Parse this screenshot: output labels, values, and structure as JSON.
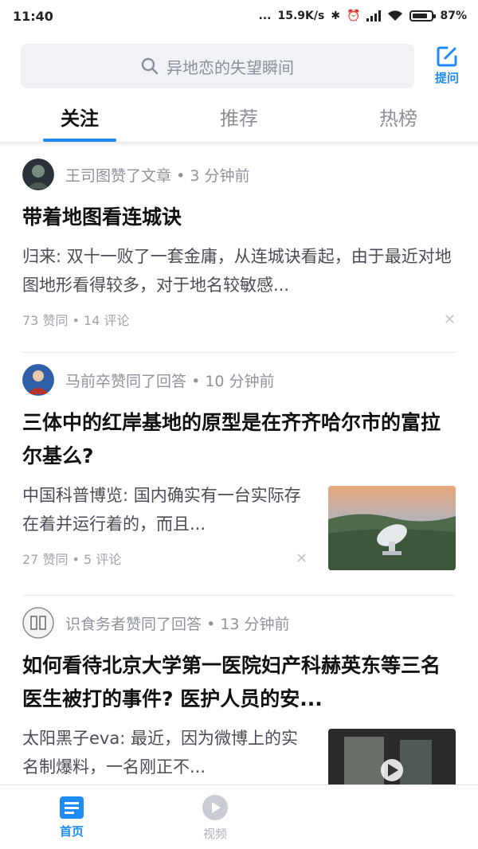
{
  "status_bar": {
    "time": "11:40",
    "dots": "...",
    "speed": "15.9K/s",
    "battery": "87%"
  },
  "header": {
    "search_placeholder": "异地恋的失望瞬间",
    "ask_label": "提问"
  },
  "tabs": [
    {
      "label": "关注",
      "active": true
    },
    {
      "label": "推荐",
      "active": false
    },
    {
      "label": "热榜",
      "active": false
    }
  ],
  "feed": [
    {
      "actor": "王司图赞了文章",
      "time_ago": "3 分钟前",
      "title": "带着地图看连城诀",
      "excerpt": "归来: 双十一败了一套金庸，从连城诀看起，由于最近对地图地形看得较多，对于地名较敏感...",
      "stats": "73 赞同 • 14 评论"
    },
    {
      "actor": "马前卒赞同了回答",
      "time_ago": "10 分钟前",
      "title": "三体中的红岸基地的原型是在齐齐哈尔市的富拉尔基么?",
      "excerpt": "中国科普博览: 国内确实有一台实际存在着并运行着的，而且...",
      "stats": "27 赞同 • 5 评论"
    },
    {
      "actor": "识食务者赞同了回答",
      "time_ago": "13 分钟前",
      "title": "如何看待北京大学第一医院妇产科赫英东等三名医生被打的事件? 医护人员的安...",
      "excerpt": "太阳黑子eva: 最近，因为微博上的实名制爆料，一名刚正不...",
      "stats": ""
    }
  ],
  "bottom_nav": [
    {
      "label": "首页",
      "active": true
    },
    {
      "label": "视频",
      "active": false
    }
  ],
  "colors": {
    "accent": "#1d8cf8",
    "muted": "#8f939c",
    "search_bg": "#f1f2f5"
  }
}
